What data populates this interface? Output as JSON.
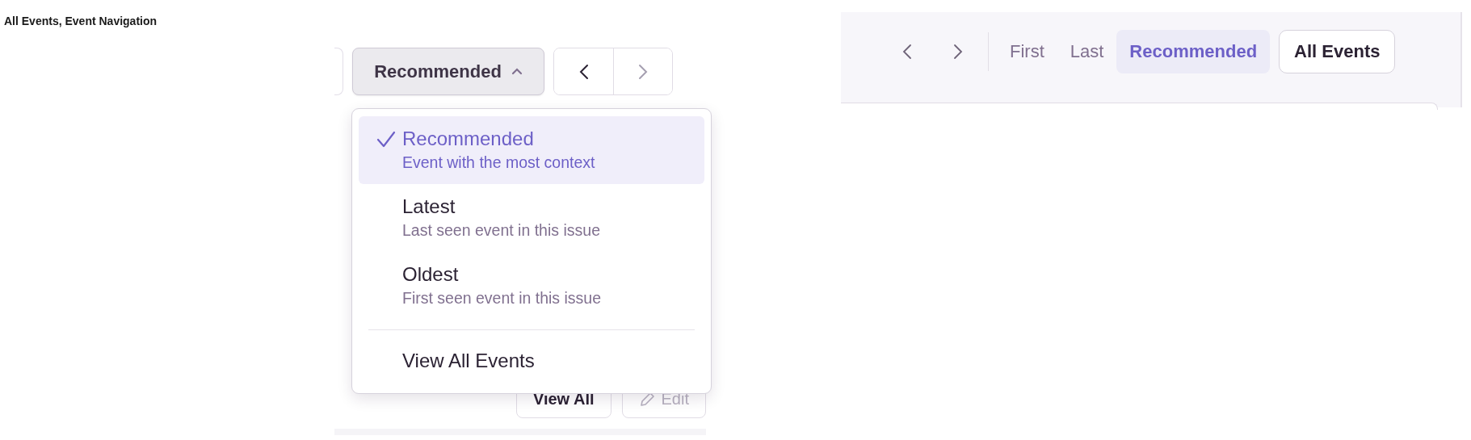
{
  "title": "All Events, Event Navigation",
  "left_panel": {
    "dropdown": {
      "label": "Recommended",
      "expanded": true
    },
    "nav": [
      {
        "kind": "prev",
        "disabled": false
      },
      {
        "kind": "next",
        "disabled": true
      }
    ],
    "menu": {
      "options": [
        {
          "label": "Recommended",
          "description": "Event with the most context",
          "selected": true
        },
        {
          "label": "Latest",
          "description": "Last seen event in this issue",
          "selected": false
        },
        {
          "label": "Oldest",
          "description": "First seen event in this issue",
          "selected": false
        }
      ],
      "footer_item": "View All Events"
    },
    "background_buttons": [
      {
        "kind": "plain",
        "label": "View All",
        "disabled": false
      },
      {
        "kind": "edit",
        "label": "Edit",
        "disabled": true
      }
    ]
  },
  "right_panel": {
    "nav": [
      {
        "kind": "prev",
        "disabled": false
      },
      {
        "kind": "next",
        "disabled": false
      }
    ],
    "tabs": [
      {
        "label": "First",
        "selected": false
      },
      {
        "label": "Last",
        "selected": false
      },
      {
        "label": "Recommended",
        "selected": true
      }
    ],
    "all_events_button": "All Events"
  }
}
